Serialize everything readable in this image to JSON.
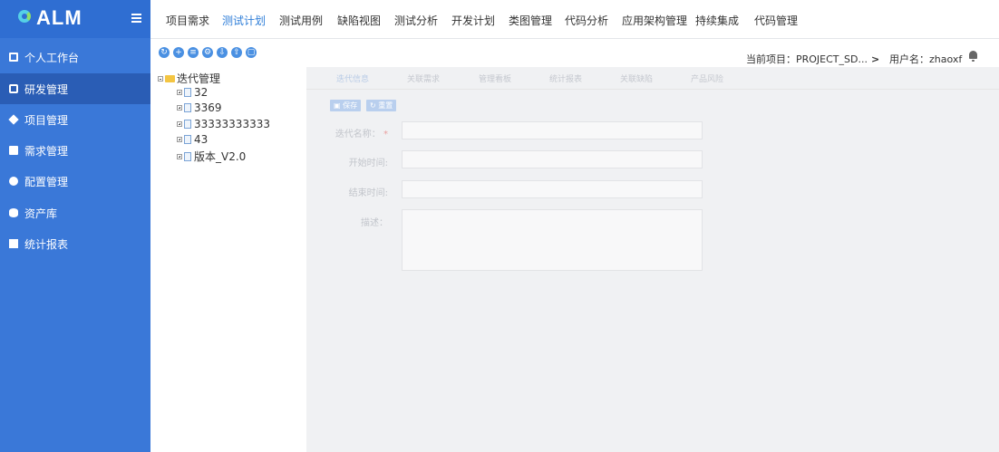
{
  "app": {
    "logo_text": "ALM"
  },
  "sidebar": {
    "items": [
      {
        "label": "个人工作台",
        "icon": "monitor-icon"
      },
      {
        "label": "研发管理",
        "icon": "document-icon",
        "active": true
      },
      {
        "label": "项目管理",
        "icon": "layers-icon"
      },
      {
        "label": "需求管理",
        "icon": "server-icon"
      },
      {
        "label": "配置管理",
        "icon": "gear-icon"
      },
      {
        "label": "资产库",
        "icon": "database-icon"
      },
      {
        "label": "统计报表",
        "icon": "chart-icon"
      }
    ]
  },
  "topnav": {
    "tabs": [
      {
        "label": "项目需求"
      },
      {
        "label": "测试计划",
        "active": true
      },
      {
        "label": "测试用例"
      },
      {
        "label": "缺陷视图"
      },
      {
        "label": "测试分析"
      },
      {
        "label": "开发计划"
      },
      {
        "label": "类图管理"
      },
      {
        "label": "代码分析"
      },
      {
        "label": "应用架构管理"
      },
      {
        "label": "持续集成"
      },
      {
        "label": "代码管理"
      }
    ],
    "accent_color": "#2f7ed8"
  },
  "toolbar": {
    "buttons": [
      "refresh-icon",
      "add-icon",
      "edit-icon",
      "settings-icon",
      "import-icon",
      "export-icon",
      "copy-icon"
    ],
    "project_label": "当前项目：PROJECT_SD...",
    "user_label": "用户名：zhaoxf"
  },
  "tree": {
    "root": "迭代管理",
    "children": [
      "32",
      "3369",
      "33333333333",
      "43",
      "版本_V2.0"
    ]
  },
  "form": {
    "tabs": [
      "迭代信息",
      "关联需求",
      "管理看板",
      "统计报表",
      "关联缺陷",
      "产品风险"
    ],
    "save_label": "保存",
    "reset_label": "重置",
    "fields": {
      "name_label": "迭代名称：",
      "name_required": "*",
      "start_label": "开始时间:",
      "end_label": "结束时间:",
      "desc_label": "描述："
    }
  }
}
